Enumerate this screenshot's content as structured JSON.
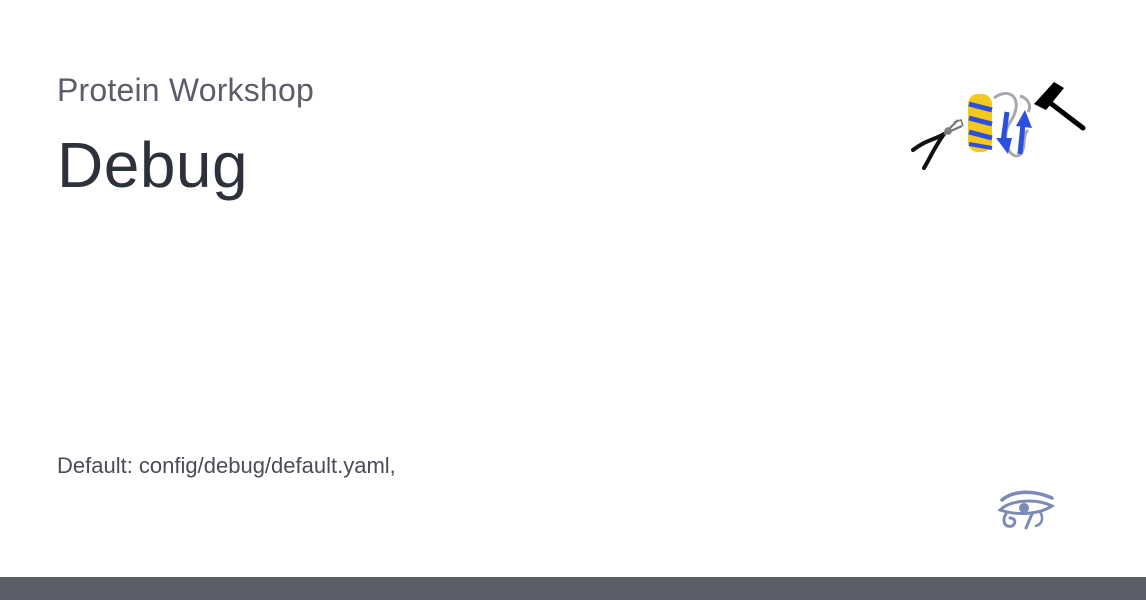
{
  "header": {
    "site_name": "Protein Workshop",
    "page_title": "Debug"
  },
  "content": {
    "description": "Default: config/debug/default.yaml,"
  },
  "icons": {
    "logo": "protein-workshop-logo-icon",
    "site_icon": "eye-of-horus-icon"
  },
  "colors": {
    "title_text": "#2d313a",
    "subtitle_text": "#5b5e69",
    "footer_bar": "#5b5e69",
    "logo_yellow": "#f4c81c",
    "logo_blue": "#2b4fe0",
    "icon_blue_gray": "#7c8bb3"
  }
}
